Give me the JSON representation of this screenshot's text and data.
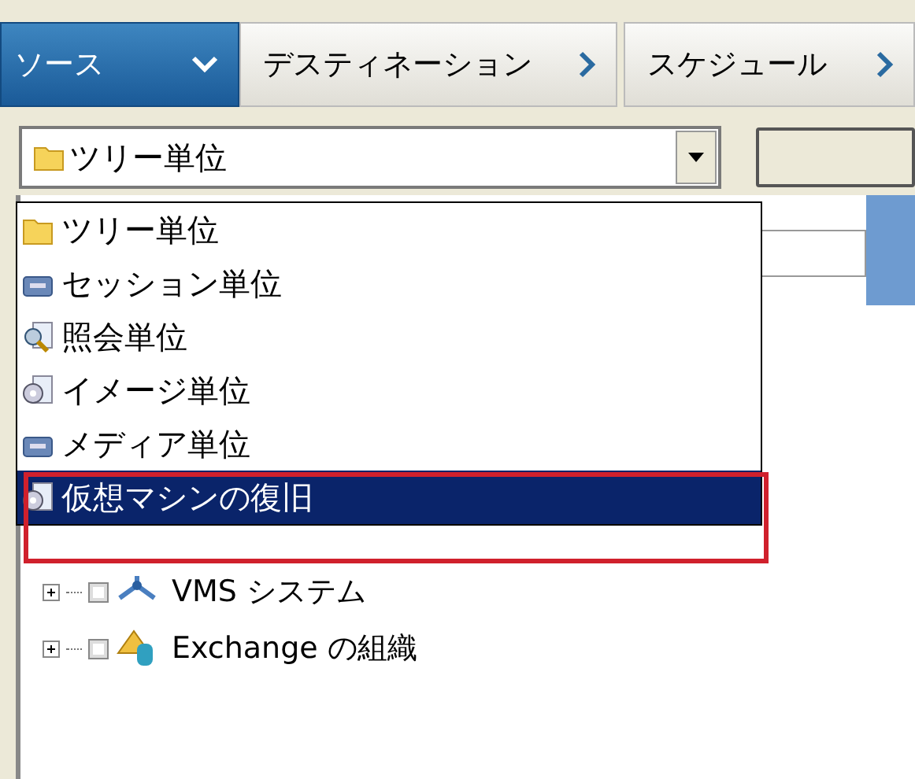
{
  "tabs": [
    {
      "label": "ソース",
      "selected": true
    },
    {
      "label": "デスティネーション",
      "selected": false
    },
    {
      "label": "スケジュール",
      "selected": false
    }
  ],
  "view_combo": {
    "value": "ツリー単位",
    "kind": "folder"
  },
  "view_dropdown": {
    "items": [
      {
        "label": "ツリー単位",
        "kind": "folder",
        "selected": false
      },
      {
        "label": "セッション単位",
        "kind": "tape",
        "selected": false
      },
      {
        "label": "照会単位",
        "kind": "search",
        "selected": false
      },
      {
        "label": "イメージ単位",
        "kind": "disc",
        "selected": false
      },
      {
        "label": "メディア単位",
        "kind": "tape",
        "selected": false
      },
      {
        "label": "仮想マシンの復旧",
        "kind": "disc",
        "selected": true
      }
    ]
  },
  "tree": [
    {
      "label": "VMS システム",
      "kind": "network",
      "checked": false,
      "expanded": false
    },
    {
      "label": "Exchange の組織",
      "kind": "exchange",
      "checked": false,
      "expanded": false
    }
  ]
}
